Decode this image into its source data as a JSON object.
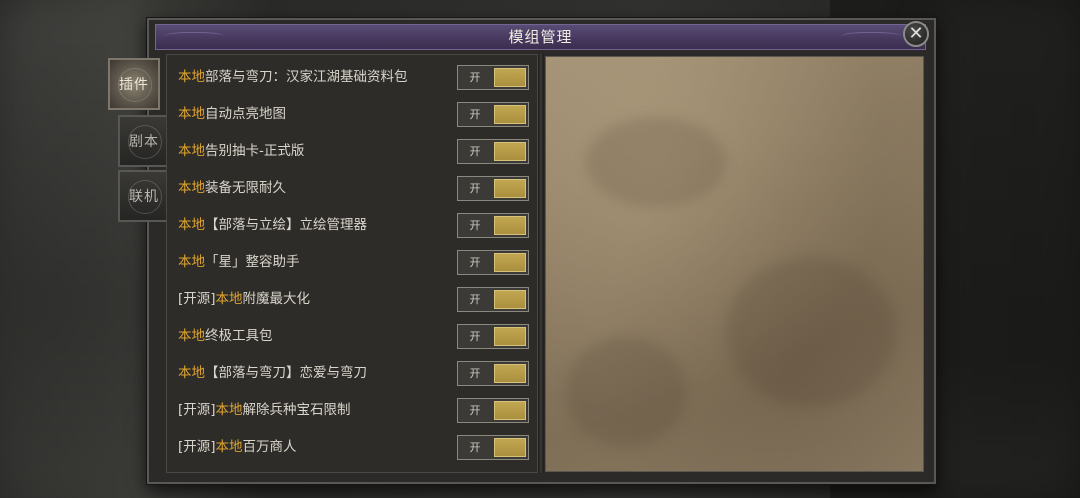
{
  "window": {
    "title": "模组管理"
  },
  "side_tabs": [
    {
      "label": "插件",
      "active": true
    },
    {
      "label": "剧本",
      "active": false
    },
    {
      "label": "联机",
      "active": false
    }
  ],
  "toggle_label": "开",
  "accent_color": "#e0a42f",
  "mods": [
    {
      "prefix": "",
      "tag": "本地",
      "name": "部落与弯刀：汉家江湖基础资料包",
      "enabled": true
    },
    {
      "prefix": "",
      "tag": "本地",
      "name": "自动点亮地图",
      "enabled": true
    },
    {
      "prefix": "",
      "tag": "本地",
      "name": "告别抽卡-正式版",
      "enabled": true
    },
    {
      "prefix": "",
      "tag": "本地",
      "name": "装备无限耐久",
      "enabled": true
    },
    {
      "prefix": "",
      "tag": "本地",
      "name": "【部落与立绘】立绘管理器",
      "enabled": true
    },
    {
      "prefix": "",
      "tag": "本地",
      "name": "「星」整容助手",
      "enabled": true
    },
    {
      "prefix": "[开源]",
      "tag": "本地",
      "name": "附魔最大化",
      "enabled": true
    },
    {
      "prefix": "",
      "tag": "本地",
      "name": "终极工具包",
      "enabled": true
    },
    {
      "prefix": "",
      "tag": "本地",
      "name": "【部落与弯刀】恋爱与弯刀",
      "enabled": true
    },
    {
      "prefix": "[开源]",
      "tag": "本地",
      "name": "解除兵种宝石限制",
      "enabled": true
    },
    {
      "prefix": "[开源]",
      "tag": "本地",
      "name": "百万商人",
      "enabled": true
    }
  ]
}
